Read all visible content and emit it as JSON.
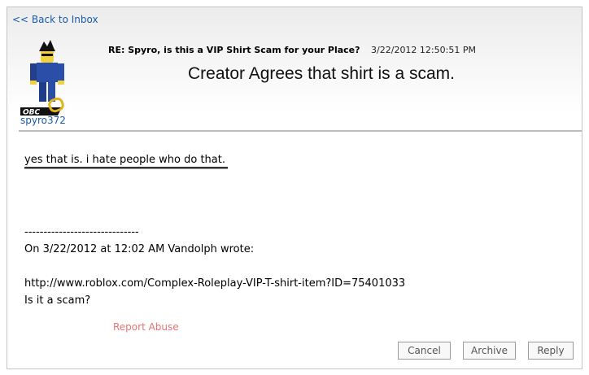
{
  "nav": {
    "back_label": "<< Back to Inbox"
  },
  "sender": {
    "username": "spyro372",
    "badge": "OBC"
  },
  "message": {
    "subject": "RE: Spyro, is this a VIP Shirt Scam for your Place?",
    "date": "3/22/2012 12:50:51 PM",
    "headline": "Creator Agrees that shirt is a scam.",
    "reply_text": "yes that is. i hate people who do that.",
    "separator": "------------------------------",
    "quote_header": "On 3/22/2012 at 12:02 AM Vandolph wrote:",
    "quote_url": "http://www.roblox.com/Complex-Roleplay-VIP-T-shirt-item?ID=75401033",
    "quote_question": "Is it a scam?"
  },
  "actions": {
    "report_label": "Report Abuse",
    "cancel_label": "Cancel",
    "archive_label": "Archive",
    "reply_label": "Reply"
  },
  "colors": {
    "link": "#1a5aa8",
    "report": "#e67373",
    "border": "#c4c4c4"
  }
}
